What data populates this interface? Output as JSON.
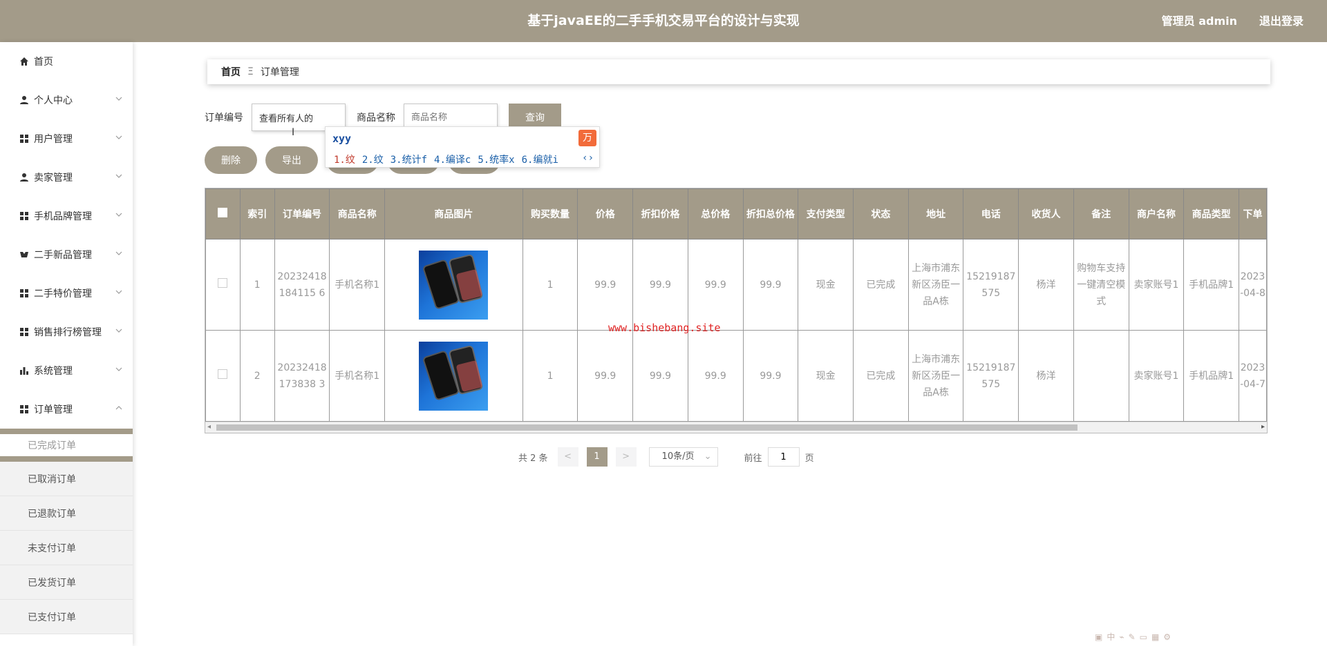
{
  "header": {
    "title": "基于javaEE的二手手机交易平台的设计与实现",
    "admin_label": "管理员 admin",
    "logout_label": "退出登录",
    "bg_color": "#a39b89"
  },
  "sidebar": {
    "items": [
      {
        "label": "首页",
        "icon": "home-icon"
      },
      {
        "label": "个人中心",
        "icon": "user-icon"
      },
      {
        "label": "用户管理",
        "icon": "grid-icon"
      },
      {
        "label": "卖家管理",
        "icon": "user-icon"
      },
      {
        "label": "手机品牌管理",
        "icon": "grid-icon"
      },
      {
        "label": "二手新品管理",
        "icon": "grid-icon"
      },
      {
        "label": "二手特价管理",
        "icon": "grid-icon"
      },
      {
        "label": "销售排行榜管理",
        "icon": "grid-icon"
      },
      {
        "label": "系统管理",
        "icon": "bar-chart-icon"
      },
      {
        "label": "订单管理",
        "icon": "grid-icon"
      }
    ],
    "sub_items": [
      "已完成订单",
      "已取消订单",
      "已退款订单",
      "未支付订单",
      "已发货订单",
      "已支付订单"
    ],
    "active_sub": "已完成订单"
  },
  "breadcrumb": {
    "home": "首页",
    "separator": "Ξ",
    "current": "订单管理"
  },
  "search": {
    "order_no_label": "订单编号",
    "order_no_value": "查看所有人的",
    "product_name_label": "商品名称",
    "product_name_placeholder": "商品名称",
    "query_button": "查询"
  },
  "ime": {
    "typed": "xyy",
    "candidates": [
      "1.纹",
      "2.纹",
      "3.统计f",
      "4.编译c",
      "5.统率x",
      "6.编就i"
    ],
    "nav": "‹›"
  },
  "actions": {
    "delete_label": "删除",
    "export_label": "导出"
  },
  "table": {
    "headers": [
      "",
      "索引",
      "订单编号",
      "商品名称",
      "商品图片",
      "购买数量",
      "价格",
      "折扣价格",
      "总价格",
      "折扣总价格",
      "支付类型",
      "状态",
      "地址",
      "电话",
      "收货人",
      "备注",
      "商户名称",
      "商品类型",
      "下单"
    ],
    "rows": [
      {
        "index": "1",
        "order_no": "20232418184115 6",
        "product_name": "手机名称1",
        "quantity": "1",
        "price": "99.9",
        "discount_price": "99.9",
        "total_price": "99.9",
        "discount_total": "99.9",
        "pay_type": "现金",
        "status": "已完成",
        "address": "上海市浦东新区汤臣一品A栋",
        "phone": "15219187575",
        "receiver": "杨洋",
        "remark": "购物车支持一键清空模式",
        "merchant": "卖家账号1",
        "category": "手机品牌1",
        "order_time": "2023-04-8"
      },
      {
        "index": "2",
        "order_no": "20232418173838 3",
        "product_name": "手机名称1",
        "quantity": "1",
        "price": "99.9",
        "discount_price": "99.9",
        "total_price": "99.9",
        "discount_total": "99.9",
        "pay_type": "现金",
        "status": "已完成",
        "address": "上海市浦东新区汤臣一品A栋",
        "phone": "15219187575",
        "receiver": "杨洋",
        "remark": "",
        "merchant": "卖家账号1",
        "category": "手机品牌1",
        "order_time": "2023-04-7"
      }
    ]
  },
  "watermark": "www.bishebang.site",
  "pagination": {
    "total": "共 2 条",
    "prev": "<",
    "current_page": "1",
    "next": ">",
    "page_size": "10条/页",
    "goto_prefix": "前往",
    "goto_value": "1",
    "goto_suffix": "页"
  }
}
